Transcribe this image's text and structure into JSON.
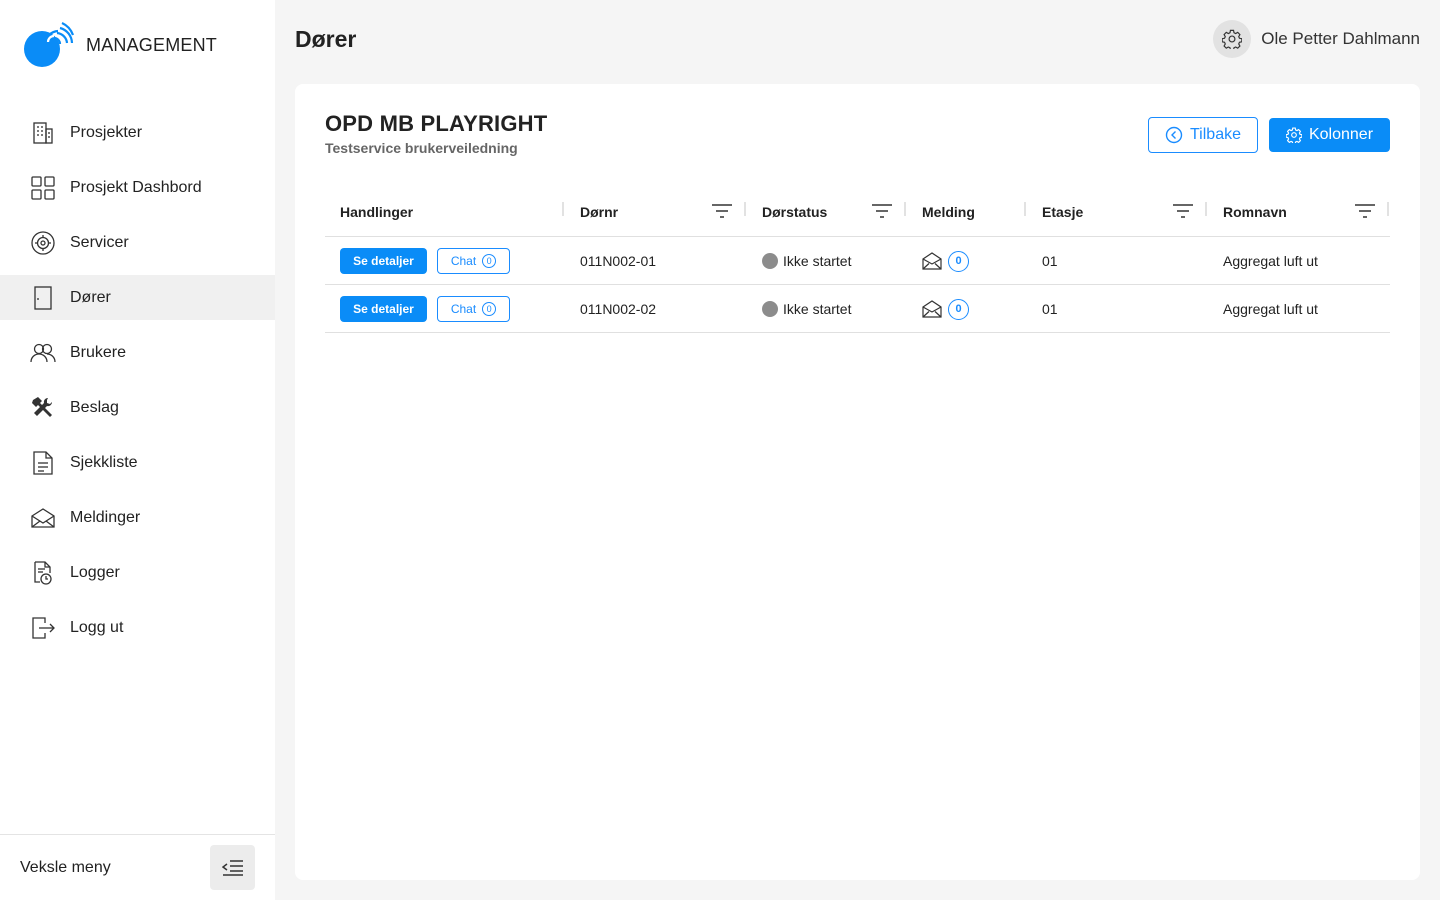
{
  "app": {
    "name": "MANAGEMENT"
  },
  "sidebar": {
    "items": [
      {
        "label": "Prosjekter",
        "icon": "building-icon",
        "active": false
      },
      {
        "label": "Prosjekt Dashbord",
        "icon": "grid-icon",
        "active": false
      },
      {
        "label": "Servicer",
        "icon": "service-gear-icon",
        "active": false
      },
      {
        "label": "Dører",
        "icon": "door-icon",
        "active": true
      },
      {
        "label": "Brukere",
        "icon": "users-icon",
        "active": false
      },
      {
        "label": "Beslag",
        "icon": "tools-icon",
        "active": false
      },
      {
        "label": "Sjekkliste",
        "icon": "document-icon",
        "active": false
      },
      {
        "label": "Meldinger",
        "icon": "envelope-icon",
        "active": false
      },
      {
        "label": "Logger",
        "icon": "log-icon",
        "active": false
      },
      {
        "label": "Logg ut",
        "icon": "logout-icon",
        "active": false
      }
    ],
    "toggle_label": "Veksle meny"
  },
  "header": {
    "title": "Dører",
    "user_name": "Ole Petter Dahlmann"
  },
  "card": {
    "title": "OPD MB PLAYRIGHT",
    "subtitle": "Testservice brukerveiledning",
    "back_label": "Tilbake",
    "columns_label": "Kolonner"
  },
  "table": {
    "headers": {
      "actions": "Handlinger",
      "door_no": "Dørnr",
      "status": "Dørstatus",
      "message": "Melding",
      "floor": "Etasje",
      "room": "Romnavn"
    },
    "details_label": "Se detaljer",
    "chat_label": "Chat",
    "rows": [
      {
        "chat_count": "0",
        "door_no": "011N002-01",
        "status": "Ikke startet",
        "message_count": "0",
        "floor": "01",
        "room": "Aggregat luft ut"
      },
      {
        "chat_count": "0",
        "door_no": "011N002-02",
        "status": "Ikke startet",
        "message_count": "0",
        "floor": "01",
        "room": "Aggregat luft ut"
      }
    ]
  },
  "colors": {
    "accent": "#0a8cf7",
    "status_not_started": "#8c8c8c",
    "active_nav_bg": "#f0f0f0"
  }
}
